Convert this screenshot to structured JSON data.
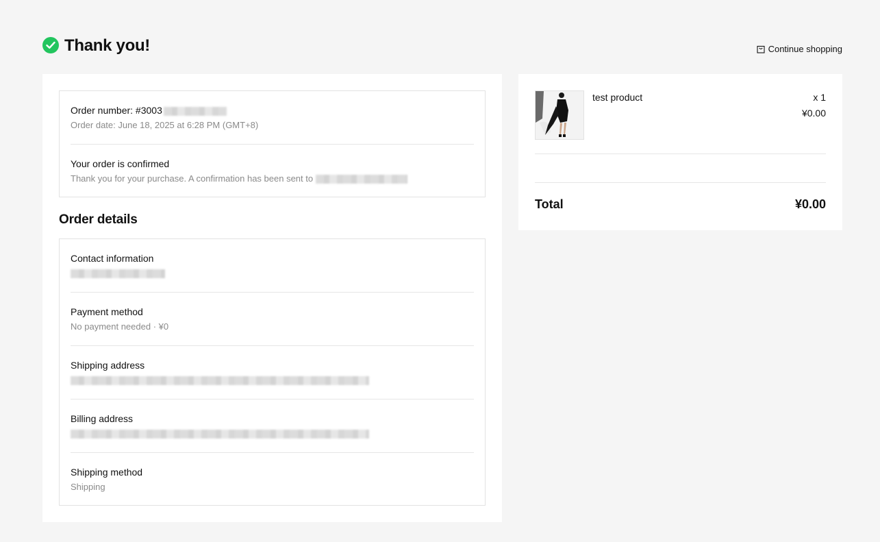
{
  "header": {
    "title": "Thank you!",
    "continue_label": "Continue shopping",
    "check_color": "#22c55e"
  },
  "order_summary": {
    "order_number": "Order number: #3003",
    "order_date": "Order date: June 18, 2025 at 6:28 PM (GMT+8)",
    "confirmed_title": "Your order is confirmed",
    "confirmed_text": "Thank you for your purchase. A confirmation has been sent to"
  },
  "details": {
    "title": "Order details",
    "contact_label": "Contact information",
    "payment_label": "Payment method",
    "payment_value": "No payment needed · ¥0",
    "shipping_address_label": "Shipping address",
    "billing_address_label": "Billing address",
    "shipping_method_label": "Shipping method",
    "shipping_method_value": "Shipping"
  },
  "cart": {
    "product_name": "test product",
    "quantity": "x 1",
    "price": "¥0.00",
    "total_label": "Total",
    "total_value": "¥0.00"
  }
}
